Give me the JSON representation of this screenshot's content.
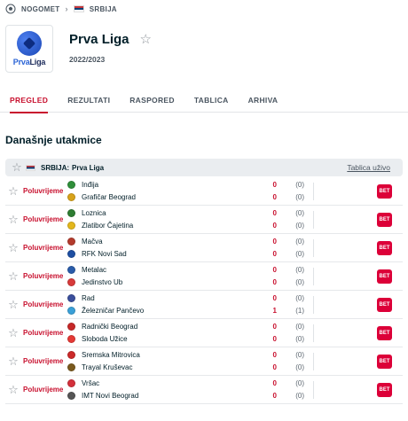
{
  "breadcrumb": {
    "sport": "NOGOMET",
    "sport_icon": "soccer-ball-icon",
    "country": "SRBIJA"
  },
  "league": {
    "name": "Prva Liga",
    "season": "2022/2023",
    "logo_text_a": "Prva",
    "logo_text_b": "Liga"
  },
  "tabs": [
    {
      "label": "PREGLED",
      "active": true
    },
    {
      "label": "REZULTATI",
      "active": false
    },
    {
      "label": "RASPORED",
      "active": false
    },
    {
      "label": "TABLICA",
      "active": false
    },
    {
      "label": "ARHIVA",
      "active": false
    }
  ],
  "section_title": "Današnje utakmice",
  "league_bar": {
    "country": "SRBIJA:",
    "league": "Prva Liga",
    "standings_link": "Tablica uživo"
  },
  "bet_label": "BET",
  "matches": [
    {
      "status": "Poluvrijeme",
      "home": "Inđija",
      "away": "Grafičar Beograd",
      "home_score": "0",
      "away_score": "0",
      "home_ht": "(0)",
      "away_ht": "(0)",
      "home_color": "#2f8f3a",
      "away_color": "#d8a31a"
    },
    {
      "status": "Poluvrijeme",
      "home": "Loznica",
      "away": "Zlatibor Čajetina",
      "home_score": "0",
      "away_score": "0",
      "home_ht": "(0)",
      "away_ht": "(0)",
      "home_color": "#2e7d32",
      "away_color": "#e3b71c"
    },
    {
      "status": "Poluvrijeme",
      "home": "Mačva",
      "away": "RFK Novi Sad",
      "home_score": "0",
      "away_score": "0",
      "home_ht": "(0)",
      "away_ht": "(0)",
      "home_color": "#b33a2c",
      "away_color": "#1e4fa3"
    },
    {
      "status": "Poluvrijeme",
      "home": "Metalac",
      "away": "Jedinstvo Ub",
      "home_score": "0",
      "away_score": "0",
      "home_ht": "(0)",
      "away_ht": "(0)",
      "home_color": "#2a5caa",
      "away_color": "#d83a3a"
    },
    {
      "status": "Poluvrijeme",
      "home": "Rad",
      "away": "Železničar Pančevo",
      "home_score": "0",
      "away_score": "1",
      "home_ht": "(0)",
      "away_ht": "(1)",
      "home_color": "#3a4f9c",
      "away_color": "#3aa0d8"
    },
    {
      "status": "Poluvrijeme",
      "home": "Radnički Beograd",
      "away": "Sloboda Užice",
      "home_score": "0",
      "away_score": "0",
      "home_ht": "(0)",
      "away_ht": "(0)",
      "home_color": "#c62828",
      "away_color": "#e53935"
    },
    {
      "status": "Poluvrijeme",
      "home": "Sremska Mitrovica",
      "away": "Trayal Kruševac",
      "home_score": "0",
      "away_score": "0",
      "home_ht": "(0)",
      "away_ht": "(0)",
      "home_color": "#cc2a2a",
      "away_color": "#7a5a1e"
    },
    {
      "status": "Poluvrijeme",
      "home": "Vršac",
      "away": "IMT Novi Beograd",
      "home_score": "0",
      "away_score": "0",
      "home_ht": "(0)",
      "away_ht": "(0)",
      "home_color": "#d4303b",
      "away_color": "#555555"
    }
  ]
}
